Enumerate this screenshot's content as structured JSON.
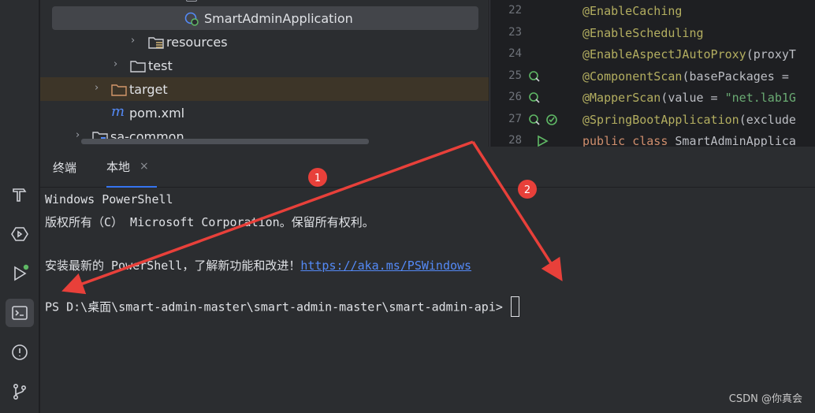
{
  "tree": {
    "items": [
      {
        "label": "SmartAdminApplication",
        "icon": "spring-class-icon"
      },
      {
        "label": "resources",
        "icon": "resources-folder-icon"
      },
      {
        "label": "test",
        "icon": "folder-icon"
      },
      {
        "label": "target",
        "icon": "folder-icon"
      },
      {
        "label": "pom.xml",
        "icon": "maven-icon"
      },
      {
        "label": "sa-common",
        "icon": "module-folder-icon"
      }
    ]
  },
  "editor": {
    "lines": [
      {
        "num": "22",
        "parts": [
          {
            "cls": "ann",
            "t": "@EnableCaching"
          }
        ]
      },
      {
        "num": "23",
        "parts": [
          {
            "cls": "ann",
            "t": "@EnableScheduling"
          }
        ]
      },
      {
        "num": "24",
        "parts": [
          {
            "cls": "ann",
            "t": "@EnableAspectJAutoProxy"
          },
          {
            "cls": "plain",
            "t": "(proxyT"
          }
        ]
      },
      {
        "num": "25",
        "parts": [
          {
            "cls": "ann",
            "t": "@ComponentScan"
          },
          {
            "cls": "plain",
            "t": "(basePackages = "
          }
        ]
      },
      {
        "num": "26",
        "parts": [
          {
            "cls": "ann",
            "t": "@MapperScan"
          },
          {
            "cls": "plain",
            "t": "(value = "
          },
          {
            "cls": "str",
            "t": "\"net.lab1G"
          }
        ]
      },
      {
        "num": "27",
        "parts": [
          {
            "cls": "ann",
            "t": "@SpringBootApplication"
          },
          {
            "cls": "plain",
            "t": "(exclude"
          }
        ]
      },
      {
        "num": "28",
        "parts": [
          {
            "cls": "kw",
            "t": "public class "
          },
          {
            "cls": "plain",
            "t": "SmartAdminApplica"
          }
        ]
      }
    ]
  },
  "panel": {
    "tab_terminal": "终端",
    "tab_local": "本地",
    "close_glyph": "×"
  },
  "terminal": {
    "line1": "Windows PowerShell",
    "line2": "版权所有（C） Microsoft Corporation。保留所有权利。",
    "line3_prefix": "安装最新的 PowerShell，了解新功能和改进！",
    "line3_link": "https://aka.ms/PSWindows",
    "prompt": "PS D:\\桌面\\smart-admin-master\\smart-admin-master\\smart-admin-api>"
  },
  "annotations": {
    "marker1": "1",
    "marker2": "2",
    "color": "#e8403a"
  },
  "watermark": "CSDN @你真会",
  "colors": {
    "accent": "#3574f0",
    "link": "#548af7",
    "annotation": "#b3ae60"
  }
}
